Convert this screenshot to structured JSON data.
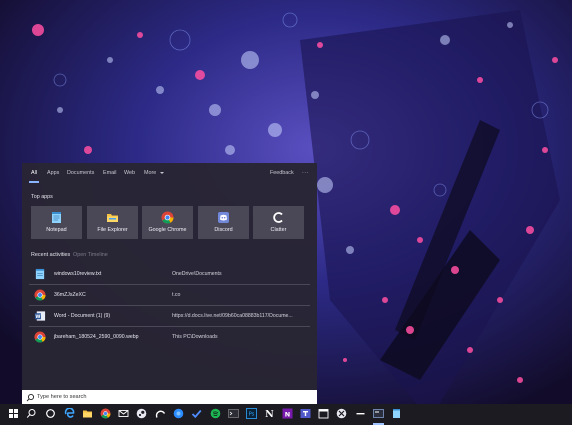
{
  "tabs": [
    {
      "label": "All",
      "active": true
    },
    {
      "label": "Apps"
    },
    {
      "label": "Documents"
    },
    {
      "label": "Email"
    },
    {
      "label": "Web"
    },
    {
      "label": "More"
    }
  ],
  "header": {
    "feedback": "Feedback",
    "more_icon": "ellipsis-icon"
  },
  "top_apps": {
    "title": "Top apps",
    "items": [
      {
        "label": "Notepad",
        "icon": "notepad-icon"
      },
      {
        "label": "File Explorer",
        "icon": "folder-icon"
      },
      {
        "label": "Google Chrome",
        "icon": "chrome-icon"
      },
      {
        "label": "Discord",
        "icon": "discord-icon"
      },
      {
        "label": "Clatter",
        "icon": "clatter-icon"
      }
    ]
  },
  "recent": {
    "title": "Recent activities",
    "timeline_link": "Open Timeline",
    "items": [
      {
        "name": "windows10review.txt",
        "location": "OneDrive\\Documents",
        "icon": "notepad-icon"
      },
      {
        "name": "36mZJsZeXC",
        "location": "t.co",
        "icon": "chrome-icon"
      },
      {
        "name": "Word - Document (1) (9)",
        "location": "https://d.docs.live.net/09b60ca08883b117/Docume...",
        "icon": "word-icon"
      },
      {
        "name": "jbareham_180524_2590_0090.webp",
        "location": "This PC\\Downloads",
        "icon": "chrome-icon"
      }
    ]
  },
  "search": {
    "placeholder": "Type here to search"
  },
  "taskbar_icons": [
    "windows-start-icon",
    "search-icon",
    "cortana-icon",
    "edge-icon",
    "file-explorer-icon",
    "chrome-icon",
    "mail-icon",
    "steam-icon",
    "store-icon",
    "todo-icon",
    "spotify-icon",
    "terminal-icon",
    "photoshop-icon",
    "notion-icon",
    "onenote-icon",
    "teams-icon",
    "calendar-icon",
    "xbox-icon",
    "dash-icon",
    "folder-icon",
    "notepad-icon"
  ],
  "colors": {
    "panel": "#282534",
    "tile": "#4a4757",
    "accent": "#8ab4ff"
  }
}
